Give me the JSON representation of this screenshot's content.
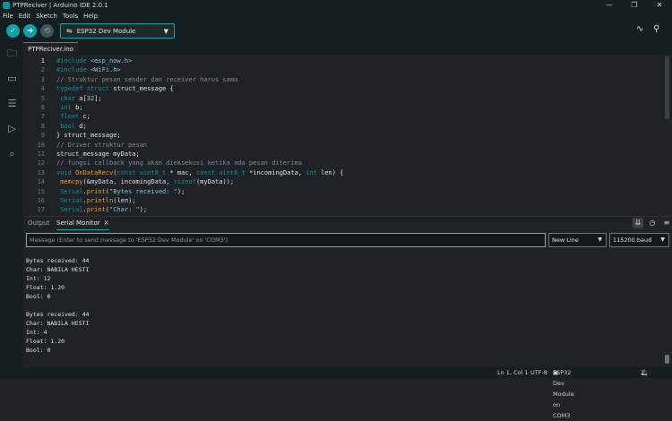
{
  "window": {
    "title": "PTPReciver | Arduino IDE 2.0.1",
    "controls": [
      "—",
      "❐",
      "✕"
    ]
  },
  "menu": [
    "File",
    "Edit",
    "Sketch",
    "Tools",
    "Help"
  ],
  "toolbar": {
    "board": "ESP32 Dev Module",
    "verify_icon": "check-icon",
    "upload_icon": "arrow-right-icon",
    "debug_icon": "debug-icon",
    "serial_plotter_icon": "pulse-icon",
    "serial_monitor_icon": "magnifier-icon"
  },
  "sidebar": [
    "folder-icon",
    "board-icon",
    "library-icon",
    "debug-icon",
    "search-icon"
  ],
  "editor": {
    "tab": "PTPReciver.ino",
    "lines": [
      {
        "n": "1",
        "html": "<span class=\"c-kw\">#include</span> <span class=\"c-str\">&lt;esp_now.h&gt;</span>"
      },
      {
        "n": "2",
        "html": "<span class=\"c-kw\">#include</span> <span class=\"c-str\">&lt;WiFi.h&gt;</span>"
      },
      {
        "n": "3",
        "html": "<span class=\"c-com\">// Struktur pesan sender dan receiver harus sama</span>"
      },
      {
        "n": "4",
        "html": "<span class=\"c-kw\">typedef</span> <span class=\"c-kw\">struct</span> struct_message {"
      },
      {
        "n": "5",
        "html": " <span class=\"c-type\">char</span> a[<span class=\"c-str\">32</span>];"
      },
      {
        "n": "6",
        "html": " <span class=\"c-type\">int</span> b;"
      },
      {
        "n": "7",
        "html": " <span class=\"c-type\">float</span> c;"
      },
      {
        "n": "8",
        "html": " <span class=\"c-type\">bool</span> d;"
      },
      {
        "n": "9",
        "html": "} struct_message;"
      },
      {
        "n": "10",
        "html": "<span class=\"c-com\">// Driver struktur pesan</span>"
      },
      {
        "n": "11",
        "html": "struct_message myData;"
      },
      {
        "n": "12",
        "html": "<span class=\"c-com\">// fungsi callback yang akan dieksekusi ketika ada pesan diterima</span>"
      },
      {
        "n": "13",
        "html": "<span class=\"c-type\">void</span> <span class=\"c-fn\">OnDataRecv</span>(<span class=\"c-kw\">const</span> <span class=\"c-type\">uint8_t</span> * mac, <span class=\"c-kw\">const</span> <span class=\"c-type\">uint8_t</span> *incomingData, <span class=\"c-type\">int</span> len) {"
      },
      {
        "n": "14",
        "html": " <span class=\"c-fn\">memcpy</span>(&amp;myData, incomingData, <span class=\"c-kw\">sizeof</span>(myData));"
      },
      {
        "n": "15",
        "html": " <span class=\"c-kw\">Serial</span>.<span class=\"c-fn\">print</span>(<span class=\"c-str\">\"Bytes received: \"</span>);"
      },
      {
        "n": "16",
        "html": " <span class=\"c-kw\">Serial</span>.<span class=\"c-fn\">println</span>(len);"
      },
      {
        "n": "17",
        "html": " <span class=\"c-kw\">Serial</span>.<span class=\"c-fn\">print</span>(<span class=\"c-str\">\"Char: \"</span>);"
      }
    ]
  },
  "panel": {
    "tabs": [
      "Output",
      "Serial Monitor"
    ],
    "close": "✕",
    "message_placeholder": "Message (Enter to send message to 'ESP32 Dev Module' on 'COM3')",
    "line_ending": "New Line",
    "baud": "115200 baud",
    "output_lines": [
      "Bytes received: 44",
      "Char: NABILA HESTI",
      "Int: 12",
      "Float: 1.20",
      "Bool: 0",
      "",
      "Bytes received: 44",
      "Char: NABILA HESTI",
      "Int: 4",
      "Float: 1.20",
      "Bool: 0"
    ]
  },
  "status": {
    "position": "Ln 1, Col 1",
    "encoding": "UTF-8",
    "board_port": "ESP32 Dev Module on COM3",
    "notifications": "2"
  },
  "colors": {
    "accent": "#00979d",
    "background": "#1f2226",
    "chrome": "#171e21"
  }
}
